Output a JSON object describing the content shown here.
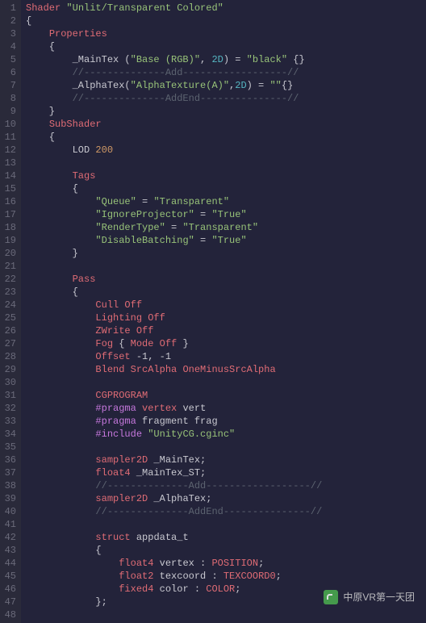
{
  "watermark": {
    "text": "中原VR第一天团"
  },
  "lines": [
    {
      "n": 1,
      "tokens": [
        [
          "k-red",
          "Shader "
        ],
        [
          "k-green",
          "\"Unlit/Transparent Colored\""
        ]
      ]
    },
    {
      "n": 2,
      "tokens": [
        [
          "k-white",
          "{"
        ]
      ]
    },
    {
      "n": 3,
      "tokens": [
        [
          "k-white",
          "    "
        ],
        [
          "k-red",
          "Properties"
        ]
      ]
    },
    {
      "n": 4,
      "tokens": [
        [
          "k-white",
          "    {"
        ]
      ]
    },
    {
      "n": 5,
      "tokens": [
        [
          "k-white",
          "        _MainTex ("
        ],
        [
          "k-green",
          "\"Base (RGB)\""
        ],
        [
          "k-white",
          ", "
        ],
        [
          "k-cyan",
          "2D"
        ],
        [
          "k-white",
          ") = "
        ],
        [
          "k-green",
          "\"black\""
        ],
        [
          "k-white",
          " {}"
        ]
      ]
    },
    {
      "n": 6,
      "tokens": [
        [
          "k-white",
          "        "
        ],
        [
          "k-comment",
          "//--------------Add------------------//"
        ]
      ]
    },
    {
      "n": 7,
      "tokens": [
        [
          "k-white",
          "        _AlphaTex("
        ],
        [
          "k-green",
          "\"AlphaTexture(A)\""
        ],
        [
          "k-white",
          ","
        ],
        [
          "k-cyan",
          "2D"
        ],
        [
          "k-white",
          ") = "
        ],
        [
          "k-green",
          "\"\""
        ],
        [
          "k-white",
          "{}"
        ]
      ]
    },
    {
      "n": 8,
      "tokens": [
        [
          "k-white",
          "        "
        ],
        [
          "k-comment",
          "//--------------AddEnd---------------//"
        ]
      ]
    },
    {
      "n": 9,
      "tokens": [
        [
          "k-white",
          "    }"
        ]
      ]
    },
    {
      "n": 10,
      "tokens": [
        [
          "k-white",
          "    "
        ],
        [
          "k-red",
          "SubShader"
        ]
      ]
    },
    {
      "n": 11,
      "tokens": [
        [
          "k-white",
          "    {"
        ]
      ]
    },
    {
      "n": 12,
      "tokens": [
        [
          "k-white",
          "        LOD "
        ],
        [
          "k-num",
          "200"
        ]
      ]
    },
    {
      "n": 13,
      "tokens": []
    },
    {
      "n": 14,
      "tokens": [
        [
          "k-white",
          "        "
        ],
        [
          "k-red",
          "Tags"
        ]
      ]
    },
    {
      "n": 15,
      "tokens": [
        [
          "k-white",
          "        {"
        ]
      ]
    },
    {
      "n": 16,
      "tokens": [
        [
          "k-white",
          "            "
        ],
        [
          "k-green",
          "\"Queue\""
        ],
        [
          "k-white",
          " = "
        ],
        [
          "k-green",
          "\"Transparent\""
        ]
      ]
    },
    {
      "n": 17,
      "tokens": [
        [
          "k-white",
          "            "
        ],
        [
          "k-green",
          "\"IgnoreProjector\""
        ],
        [
          "k-white",
          " = "
        ],
        [
          "k-green",
          "\"True\""
        ]
      ]
    },
    {
      "n": 18,
      "tokens": [
        [
          "k-white",
          "            "
        ],
        [
          "k-green",
          "\"RenderType\""
        ],
        [
          "k-white",
          " = "
        ],
        [
          "k-green",
          "\"Transparent\""
        ]
      ]
    },
    {
      "n": 19,
      "tokens": [
        [
          "k-white",
          "            "
        ],
        [
          "k-green",
          "\"DisableBatching\""
        ],
        [
          "k-white",
          " = "
        ],
        [
          "k-green",
          "\"True\""
        ]
      ]
    },
    {
      "n": 20,
      "tokens": [
        [
          "k-white",
          "        }"
        ]
      ]
    },
    {
      "n": 21,
      "tokens": []
    },
    {
      "n": 22,
      "tokens": [
        [
          "k-white",
          "        "
        ],
        [
          "k-red",
          "Pass"
        ]
      ]
    },
    {
      "n": 23,
      "tokens": [
        [
          "k-white",
          "        {"
        ]
      ]
    },
    {
      "n": 24,
      "tokens": [
        [
          "k-white",
          "            "
        ],
        [
          "k-red",
          "Cull Off"
        ]
      ]
    },
    {
      "n": 25,
      "tokens": [
        [
          "k-white",
          "            "
        ],
        [
          "k-red",
          "Lighting Off"
        ]
      ]
    },
    {
      "n": 26,
      "tokens": [
        [
          "k-white",
          "            "
        ],
        [
          "k-red",
          "ZWrite Off"
        ]
      ]
    },
    {
      "n": 27,
      "tokens": [
        [
          "k-white",
          "            "
        ],
        [
          "k-red",
          "Fog"
        ],
        [
          "k-white",
          " { "
        ],
        [
          "k-red",
          "Mode Off"
        ],
        [
          "k-white",
          " }"
        ]
      ]
    },
    {
      "n": 28,
      "tokens": [
        [
          "k-white",
          "            "
        ],
        [
          "k-red",
          "Offset"
        ],
        [
          "k-white",
          " -1, -1"
        ]
      ]
    },
    {
      "n": 29,
      "tokens": [
        [
          "k-white",
          "            "
        ],
        [
          "k-red",
          "Blend SrcAlpha OneMinusSrcAlpha"
        ]
      ]
    },
    {
      "n": 30,
      "tokens": []
    },
    {
      "n": 31,
      "tokens": [
        [
          "k-white",
          "            "
        ],
        [
          "k-red",
          "CGPROGRAM"
        ]
      ]
    },
    {
      "n": 32,
      "tokens": [
        [
          "k-white",
          "            "
        ],
        [
          "k-purple",
          "#pragma"
        ],
        [
          "k-white",
          " "
        ],
        [
          "k-red",
          "vertex"
        ],
        [
          "k-white",
          " vert"
        ]
      ]
    },
    {
      "n": 33,
      "tokens": [
        [
          "k-white",
          "            "
        ],
        [
          "k-purple",
          "#pragma"
        ],
        [
          "k-white",
          " fragment frag"
        ]
      ]
    },
    {
      "n": 34,
      "tokens": [
        [
          "k-white",
          "            "
        ],
        [
          "k-purple",
          "#include"
        ],
        [
          "k-white",
          " "
        ],
        [
          "k-green",
          "\"UnityCG.cginc\""
        ]
      ]
    },
    {
      "n": 35,
      "tokens": []
    },
    {
      "n": 36,
      "tokens": [
        [
          "k-white",
          "            "
        ],
        [
          "k-red",
          "sampler2D"
        ],
        [
          "k-white",
          " _MainTex;"
        ]
      ]
    },
    {
      "n": 37,
      "tokens": [
        [
          "k-white",
          "            "
        ],
        [
          "k-red",
          "float4"
        ],
        [
          "k-white",
          " _MainTex_ST;"
        ]
      ]
    },
    {
      "n": 38,
      "tokens": [
        [
          "k-white",
          "            "
        ],
        [
          "k-comment",
          "//--------------Add------------------//"
        ]
      ]
    },
    {
      "n": 39,
      "tokens": [
        [
          "k-white",
          "            "
        ],
        [
          "k-red",
          "sampler2D"
        ],
        [
          "k-white",
          " _AlphaTex;"
        ]
      ]
    },
    {
      "n": 40,
      "tokens": [
        [
          "k-white",
          "            "
        ],
        [
          "k-comment",
          "//--------------AddEnd---------------//"
        ]
      ]
    },
    {
      "n": 41,
      "tokens": []
    },
    {
      "n": 42,
      "tokens": [
        [
          "k-white",
          "            "
        ],
        [
          "k-red",
          "struct"
        ],
        [
          "k-white",
          " appdata_t"
        ]
      ]
    },
    {
      "n": 43,
      "tokens": [
        [
          "k-white",
          "            {"
        ]
      ]
    },
    {
      "n": 44,
      "tokens": [
        [
          "k-white",
          "                "
        ],
        [
          "k-red",
          "float4"
        ],
        [
          "k-white",
          " vertex : "
        ],
        [
          "k-red",
          "POSITION"
        ],
        [
          "k-white",
          ";"
        ]
      ]
    },
    {
      "n": 45,
      "tokens": [
        [
          "k-white",
          "                "
        ],
        [
          "k-red",
          "float2"
        ],
        [
          "k-white",
          " texcoord : "
        ],
        [
          "k-red",
          "TEXCOORD0"
        ],
        [
          "k-white",
          ";"
        ]
      ]
    },
    {
      "n": 46,
      "tokens": [
        [
          "k-white",
          "                "
        ],
        [
          "k-red",
          "fixed4"
        ],
        [
          "k-white",
          " color : "
        ],
        [
          "k-red",
          "COLOR"
        ],
        [
          "k-white",
          ";"
        ]
      ]
    },
    {
      "n": 47,
      "tokens": [
        [
          "k-white",
          "            };"
        ]
      ]
    },
    {
      "n": 48,
      "tokens": []
    }
  ]
}
